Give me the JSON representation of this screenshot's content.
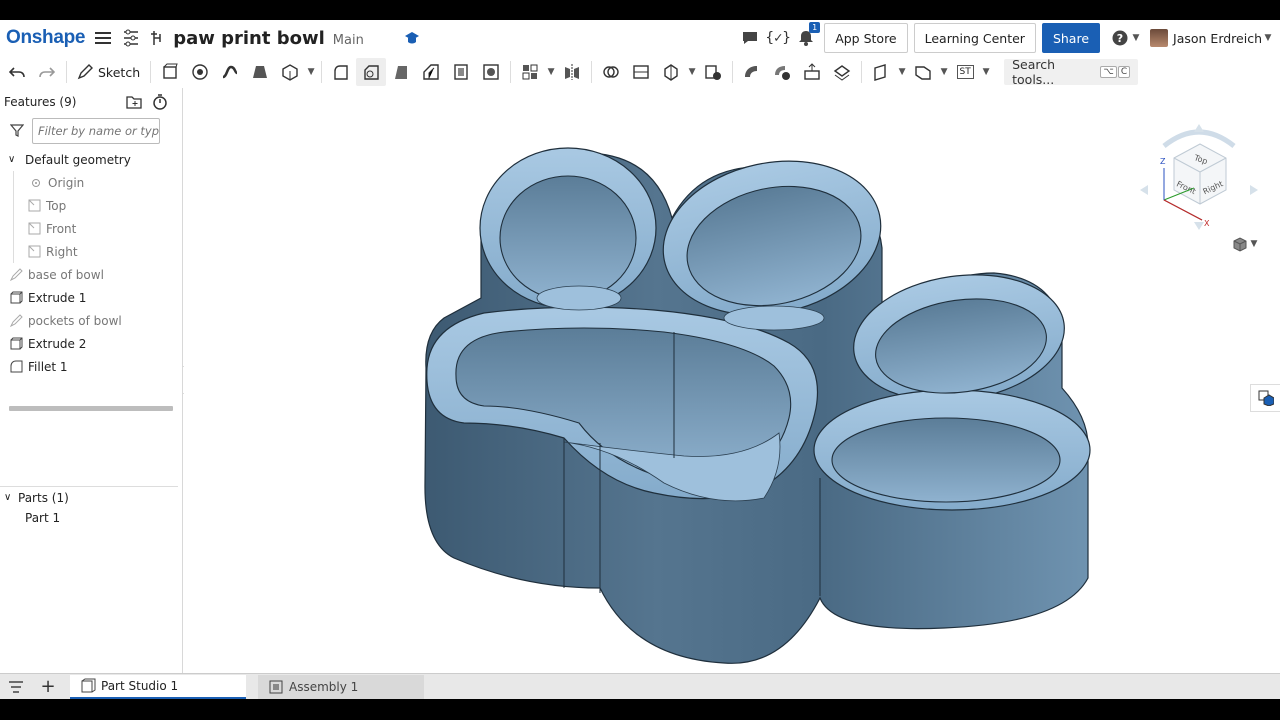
{
  "app": {
    "logo": "Onshape",
    "doc_title": "paw print bowl",
    "branch": "Main"
  },
  "header": {
    "notification_count": "1",
    "app_store_label": "App Store",
    "learning_center_label": "Learning Center",
    "share_label": "Share",
    "user_name": "Jason Erdreich"
  },
  "toolbar": {
    "sketch_label": "Sketch",
    "search_label": "Search tools...",
    "search_key1": "⌥",
    "search_key2": "C",
    "st_label": "ST"
  },
  "features": {
    "title": "Features (9)",
    "filter_placeholder": "Filter by name or type",
    "default_geometry": "Default geometry",
    "items": [
      {
        "label": "Origin",
        "icon": "origin-icon"
      },
      {
        "label": "Top",
        "icon": "plane-icon"
      },
      {
        "label": "Front",
        "icon": "plane-icon"
      },
      {
        "label": "Right",
        "icon": "plane-icon"
      },
      {
        "label": "base of bowl",
        "icon": "sketch-icon"
      },
      {
        "label": "Extrude 1",
        "icon": "extrude-icon"
      },
      {
        "label": "pockets of bowl",
        "icon": "sketch-icon"
      },
      {
        "label": "Extrude 2",
        "icon": "extrude-icon"
      },
      {
        "label": "Fillet 1",
        "icon": "fillet-icon"
      }
    ]
  },
  "parts": {
    "title": "Parts (1)",
    "items": [
      "Part 1"
    ]
  },
  "view_cube": {
    "top": "Top",
    "front": "Front",
    "right": "Right",
    "z": "Z",
    "x": "X"
  },
  "tabs": [
    {
      "label": "Part Studio 1",
      "active": true
    },
    {
      "label": "Assembly 1",
      "active": false
    }
  ],
  "colors": {
    "brand": "#1a5fb4",
    "model_top": "#8fb4d2",
    "model_side": "#4d6f8a"
  }
}
